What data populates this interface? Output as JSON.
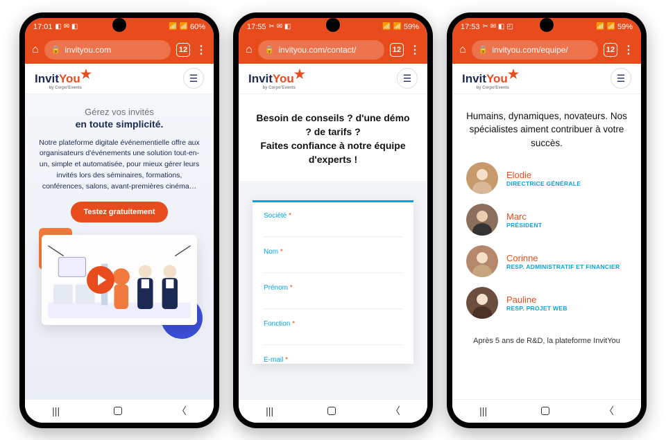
{
  "phones": [
    {
      "status": {
        "time": "17:01",
        "icons_left": "◧ ✉ ◧",
        "signal": "📶 📶",
        "battery": "60%"
      },
      "browser": {
        "url": "invityou.com",
        "tabs": "12"
      },
      "logo": {
        "brand1": "Invit",
        "brand2": "You",
        "sub": "by Corpo'Events"
      },
      "hero": {
        "title1": "Gérez vos invités",
        "title2": "en toute simplicité.",
        "body": "Notre plateforme digitale événementielle offre aux organisateurs d'événements une solution tout-en-un, simple et automatisée, pour mieux gérer leurs invités lors des séminaires, formations, conférences, salons, avant-premières cinéma…",
        "cta": "Testez gratuitement"
      }
    },
    {
      "status": {
        "time": "17:55",
        "icons_left": "✂ ✉ ◧",
        "signal": "📶 📶",
        "battery": "59%"
      },
      "browser": {
        "url": "invityou.com/contact/",
        "tabs": "12"
      },
      "logo": {
        "brand1": "Invit",
        "brand2": "You",
        "sub": "by Corpo'Events"
      },
      "contact": {
        "heading": "Besoin de conseils ? d'une démo ? de tarifs ?\nFaites confiance à notre équipe d'experts !",
        "fields": [
          {
            "label": "Société"
          },
          {
            "label": "Nom"
          },
          {
            "label": "Prénom"
          },
          {
            "label": "Fonction"
          },
          {
            "label": "E-mail"
          }
        ]
      }
    },
    {
      "status": {
        "time": "17:53",
        "icons_left": "✂ ✉ ◧ ◰",
        "signal": "📶 📶",
        "battery": "59%"
      },
      "browser": {
        "url": "invityou.com/equipe/",
        "tabs": "12"
      },
      "logo": {
        "brand1": "Invit",
        "brand2": "You",
        "sub": "by Corpo'Events"
      },
      "team": {
        "heading": "Humains, dynamiques, novateurs. Nos spécialistes aiment contribuer à votre succès.",
        "members": [
          {
            "name": "Elodie",
            "role": "DIRECTRICE GÉNÉRALE",
            "color": "#C79A6B"
          },
          {
            "name": "Marc",
            "role": "PRÉSIDENT",
            "color": "#8B6F5C"
          },
          {
            "name": "Corinne",
            "role": "RESP. ADMINISTRATIF ET FINANCIER",
            "color": "#B5876B"
          },
          {
            "name": "Pauline",
            "role": "RESP. PROJET WEB",
            "color": "#6B4E3D"
          }
        ],
        "footer": "Après 5 ans de R&D, la plateforme InvitYou"
      }
    }
  ]
}
